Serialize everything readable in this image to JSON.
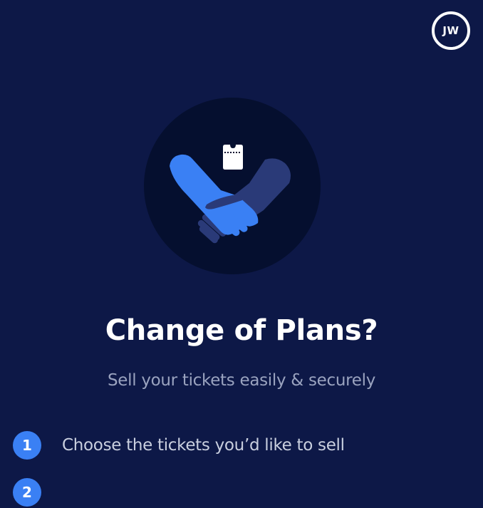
{
  "avatar": {
    "initials": "JW"
  },
  "hero": {
    "illustration": "handshake-ticket-icon"
  },
  "title": "Change of Plans?",
  "subtitle": "Sell your tickets easily & securely",
  "steps": [
    {
      "number": "1",
      "text": "Choose the tickets you’d like to sell"
    },
    {
      "number": "2",
      "text": ""
    }
  ],
  "colors": {
    "background": "#0d1847",
    "hero_circle": "#050f2f",
    "accent_blue": "#3a80f4",
    "hand_dark": "#2a3a78",
    "subtitle_text": "#9aa3bf"
  }
}
